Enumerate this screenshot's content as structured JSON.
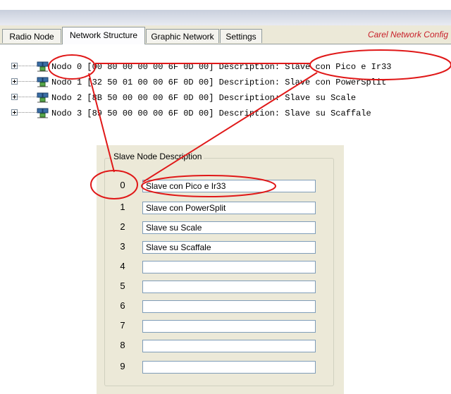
{
  "tabs": [
    {
      "label": "Radio Node",
      "active": false
    },
    {
      "label": "Network Structure",
      "active": true
    },
    {
      "label": "Graphic Network",
      "active": false
    },
    {
      "label": "Settings",
      "active": false
    }
  ],
  "brand": "Carel Network Config",
  "tree": [
    {
      "text": "Nodo 0 [00 80 00 00 00 6F 0D 00] Description: Slave con Pico e Ir33"
    },
    {
      "text": "Nodo 1 [32 50 01 00 00 6F 0D 00] Description: Slave con PowerSplit"
    },
    {
      "text": "Nodo 2 [8B 50 00 00 00 6F 0D 00] Description: Slave su Scale"
    },
    {
      "text": "Nodo 3 [89 50 00 00 00 6F 0D 00] Description: Slave su Scaffale"
    }
  ],
  "slave_panel": {
    "title": "Slave Node Description",
    "rows": [
      {
        "label": "0",
        "value": "Slave con Pico e Ir33"
      },
      {
        "label": "1",
        "value": "Slave con PowerSplit"
      },
      {
        "label": "2",
        "value": "Slave su Scale"
      },
      {
        "label": "3",
        "value": "Slave su Scaffale"
      },
      {
        "label": "4",
        "value": ""
      },
      {
        "label": "5",
        "value": ""
      },
      {
        "label": "6",
        "value": ""
      },
      {
        "label": "7",
        "value": ""
      },
      {
        "label": "8",
        "value": ""
      },
      {
        "label": "9",
        "value": ""
      }
    ]
  },
  "colors": {
    "annotation": "#e01818",
    "brand": "#c8202a",
    "panel_bg": "#ece9d8"
  }
}
